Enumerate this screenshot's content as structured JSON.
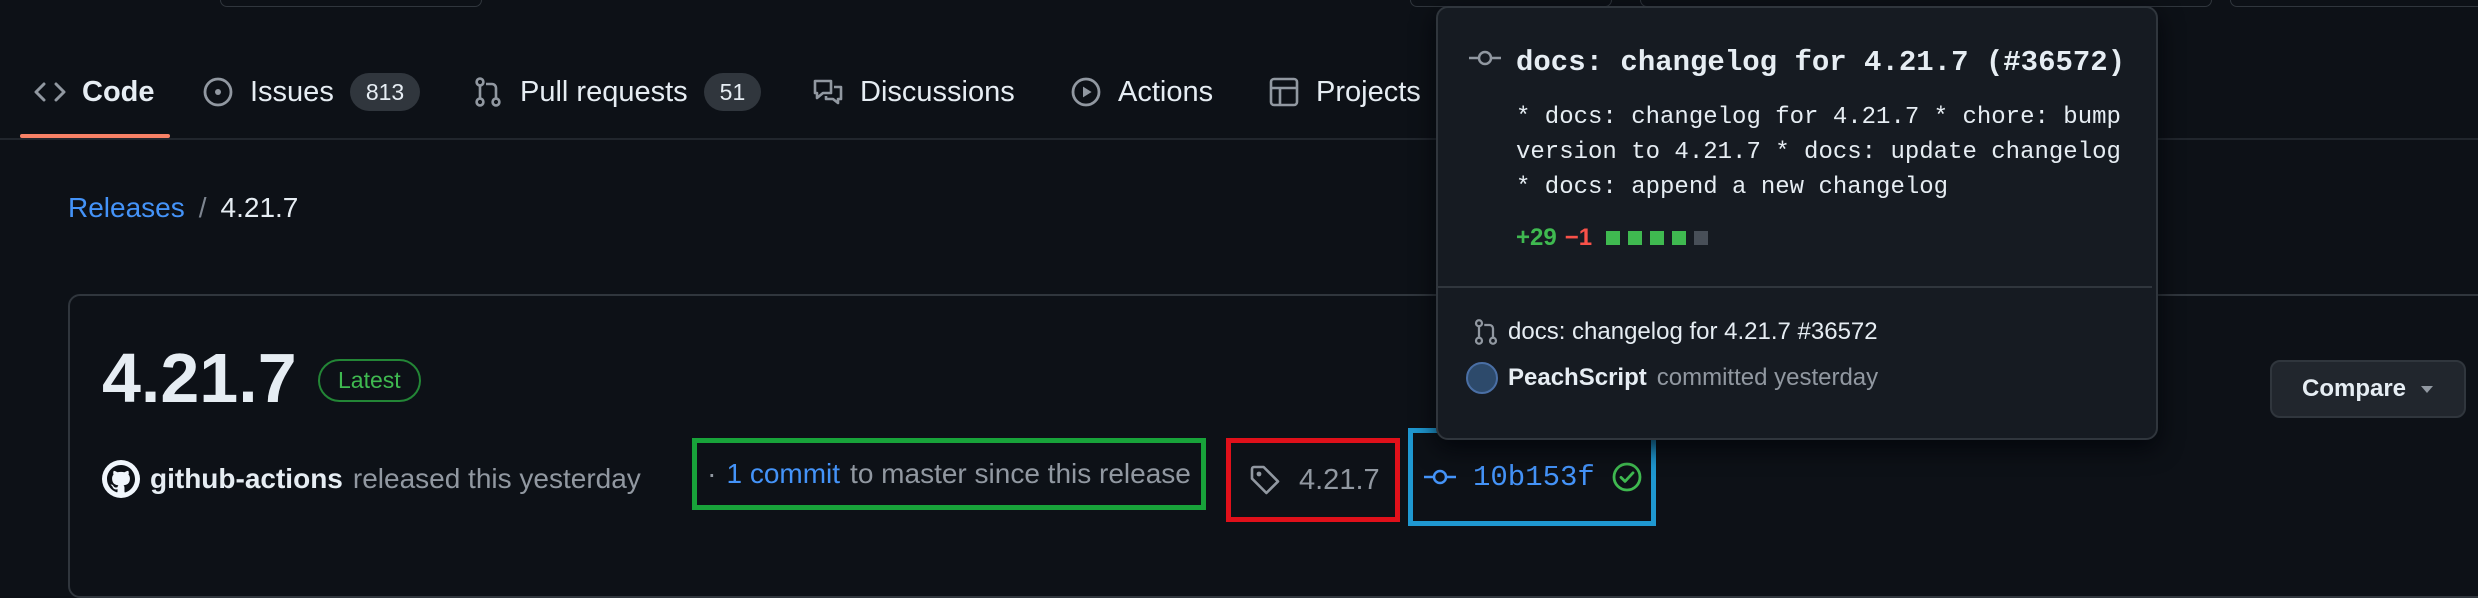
{
  "nav": {
    "tabs": [
      {
        "label": "Code",
        "count": null,
        "selected": true
      },
      {
        "label": "Issues",
        "count": "813"
      },
      {
        "label": "Pull requests",
        "count": "51"
      },
      {
        "label": "Discussions",
        "count": null
      },
      {
        "label": "Actions",
        "count": null
      },
      {
        "label": "Projects",
        "count": null
      }
    ]
  },
  "breadcrumb": {
    "parent": "Releases",
    "separator": "/",
    "current": "4.21.7"
  },
  "release": {
    "title": "4.21.7",
    "badge": "Latest",
    "author": "github-actions",
    "released_text": "released this yesterday",
    "commits_link": "1 commit",
    "commits_suffix": "to master since this release",
    "commits_prefix": "·",
    "tag": "4.21.7",
    "commit_sha": "10b153f",
    "compare_label": "Compare"
  },
  "popover": {
    "title": "docs: changelog for 4.21.7 (#36572)",
    "body": "* docs: changelog for 4.21.7 * chore: bump version to 4.21.7 * docs: update changelog * docs: append a new changelog",
    "additions": "+29",
    "deletions": "−1",
    "diff_blocks": [
      "green",
      "green",
      "green",
      "green",
      "grey"
    ],
    "pr_text": "docs: changelog for 4.21.7 #36572",
    "committer": "PeachScript",
    "committed_text": "committed yesterday"
  },
  "colors": {
    "background": "#0d1117",
    "link": "#4493f8",
    "success": "#3fb950",
    "danger": "#f85149",
    "tab_underline": "#f78166",
    "highlight_green": "#18a33a",
    "highlight_red": "#e0101a",
    "highlight_blue": "#1f98d1"
  },
  "icons": [
    "code-icon",
    "issue-icon",
    "pull-request-icon",
    "discussion-icon",
    "play-icon",
    "table-icon",
    "tag-icon",
    "git-commit-icon",
    "check-circle-icon",
    "triangle-down-icon",
    "github-mark-icon"
  ]
}
